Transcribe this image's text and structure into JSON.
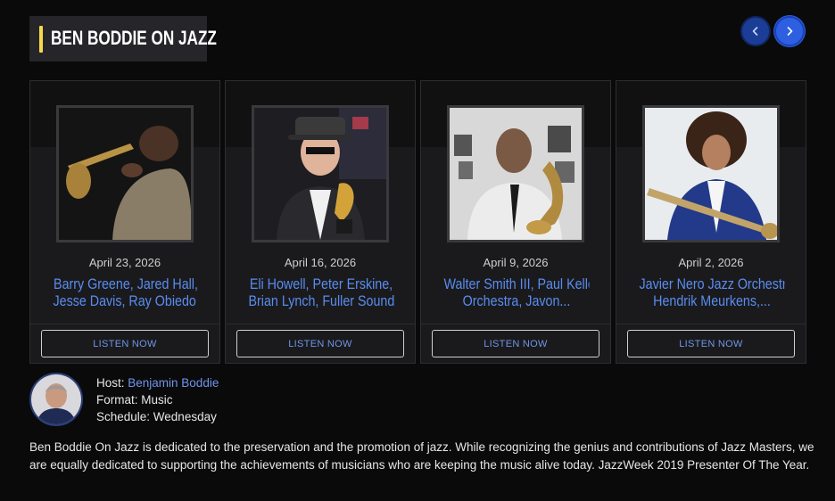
{
  "show": {
    "title": "BEN BODDIE ON JAZZ"
  },
  "nav": {
    "prev_icon": "chevron-left-icon",
    "next_icon": "chevron-right-icon"
  },
  "episodes": [
    {
      "date": "April 23, 2026",
      "name_line1": "Barry Greene, Jared Hall,",
      "name_line2": "Jesse Davis, Ray Obiedo And...",
      "button": "LISTEN NOW"
    },
    {
      "date": "April 16, 2026",
      "name_line1": "Eli Howell, Peter Erskine,",
      "name_line2": "Brian Lynch, Fuller Sound...",
      "button": "LISTEN NOW"
    },
    {
      "date": "April 9, 2026",
      "name_line1": "Walter Smith III, Paul Keller",
      "name_line2": "Orchestra, Javon...",
      "button": "LISTEN NOW"
    },
    {
      "date": "April 2, 2026",
      "name_line1": "Javier Nero Jazz Orchestra,",
      "name_line2": "Hendrik Meurkens,...",
      "button": "LISTEN NOW"
    }
  ],
  "host": {
    "host_label": "Host: ",
    "host_name": "Benjamin Boddie",
    "format_label": "Format: ",
    "format_value": "Music",
    "schedule_label": "Schedule: ",
    "schedule_value": "Wednesday"
  },
  "description": "Ben Boddie On Jazz is dedicated to the preservation and the promotion of jazz. While recognizing the genius and contributions of Jazz Masters, we are equally dedicated to supporting the achievements of musicians who are keeping the music alive today. JazzWeek 2019 Presenter Of The Year.",
  "colors": {
    "accent": "#f5d94a",
    "link": "#5a8cf0",
    "nav_active": "#2e5fe0",
    "background": "#0a0a0b"
  }
}
